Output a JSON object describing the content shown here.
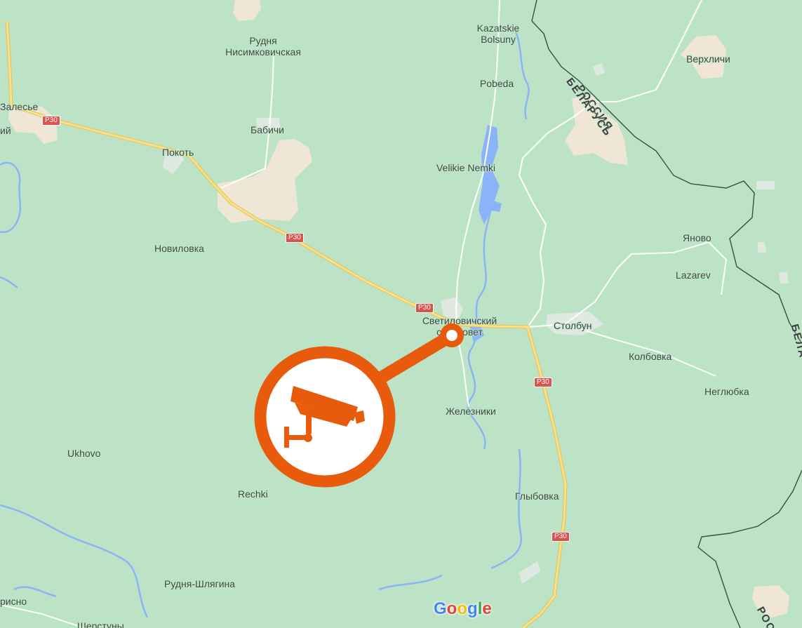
{
  "map": {
    "provider_logo": [
      "G",
      "o",
      "o",
      "g",
      "l",
      "e"
    ],
    "provider_logo_colors": [
      "#4285f4",
      "#ea4335",
      "#fbbc05",
      "#4285f4",
      "#34a853",
      "#ea4335"
    ],
    "colors": {
      "land": "#bde3c6",
      "settlement": "#efe6d6",
      "water": "#8ab4f8",
      "highway": "#f5d76e",
      "road": "#ffffff",
      "border": "#3d4a45",
      "marker": "#e85a0c",
      "shield": "#d9534f"
    },
    "marker": {
      "icon": "cctv-camera-icon",
      "label": ""
    },
    "places": {
      "rudnya_nisimk_1": "Рудня",
      "rudnya_nisimk_2": "Нисимковичская",
      "kazatskie_1": "Kazatskie",
      "kazatskie_2": "Bolsuny",
      "pobeda": "Pobeda",
      "verkhlichi": "Верхличи",
      "zalesye": "Залесье",
      "zalesye_left": "ий",
      "babichi": "Бабичи",
      "pokot": "Покоть",
      "velikie_nemki": "Velikie Nemki",
      "novilovka": "Новиловка",
      "yanovo": "Яново",
      "lazarev": "Lazarev",
      "svetil_1": "Светиловичский",
      "svetil_2": "сельсовет",
      "stolbun": "Столбун",
      "kolbovka": "Колбовка",
      "neglyubka": "Неглюбка",
      "zhelezniki": "Железники",
      "ukhovo": "Ukhovo",
      "rechki": "Rechki",
      "glybovka": "Глыбовка",
      "rudnya_shlyagina": "Рудня-Шлягина",
      "risno": "рисно",
      "sheptuny": "Шерстуны"
    },
    "borders": {
      "russia": "РОССИЯ",
      "belarus": "БЕЛАРУСЬ",
      "belarus_right": "БЕЛА",
      "russia_bottom": "РОС"
    },
    "road_shields": [
      "Р30",
      "Р30",
      "Р30",
      "Р30",
      "Р30"
    ]
  }
}
